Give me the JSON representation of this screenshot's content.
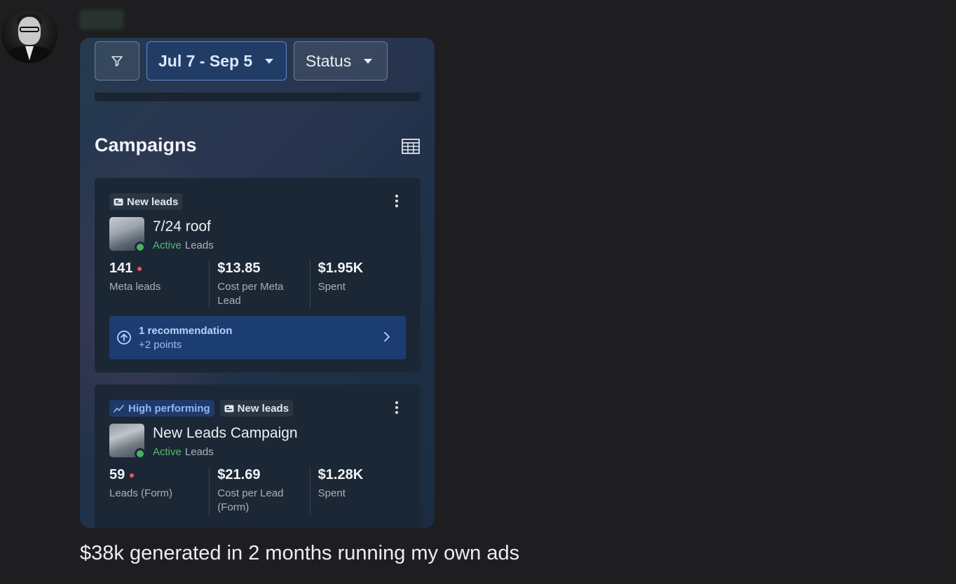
{
  "toolbar": {
    "filter_icon": "filter-icon",
    "date_range": "Jul 7 - Sep 5",
    "status_label": "Status"
  },
  "section_title": "Campaigns",
  "campaigns": [
    {
      "tags": [
        {
          "icon": "lead-form-icon",
          "label": "New leads"
        }
      ],
      "name": "7/24 roof",
      "status": "Active",
      "objective": "Leads",
      "metrics": [
        {
          "value": "141",
          "label": "Meta leads",
          "alert": true
        },
        {
          "value": "$13.85",
          "label": "Cost per Meta Lead"
        },
        {
          "value": "$1.95K",
          "label": "Spent"
        }
      ],
      "recommendation": {
        "title": "1 recommendation",
        "sub": "+2 points"
      }
    },
    {
      "tags": [
        {
          "icon": "trend-icon",
          "label": "High performing"
        },
        {
          "icon": "lead-form-icon",
          "label": "New leads"
        }
      ],
      "name": "New Leads Campaign",
      "status": "Active",
      "objective": "Leads",
      "metrics": [
        {
          "value": "59",
          "label": "Leads (Form)",
          "alert": true
        },
        {
          "value": "$21.69",
          "label": "Cost per Lead (Form)"
        },
        {
          "value": "$1.28K",
          "label": "Spent"
        }
      ]
    }
  ],
  "caption": "$38k generated in 2 months running my own ads",
  "colors": {
    "accent": "#1c3d72",
    "active": "#55b870",
    "alert": "#e05a5a"
  }
}
